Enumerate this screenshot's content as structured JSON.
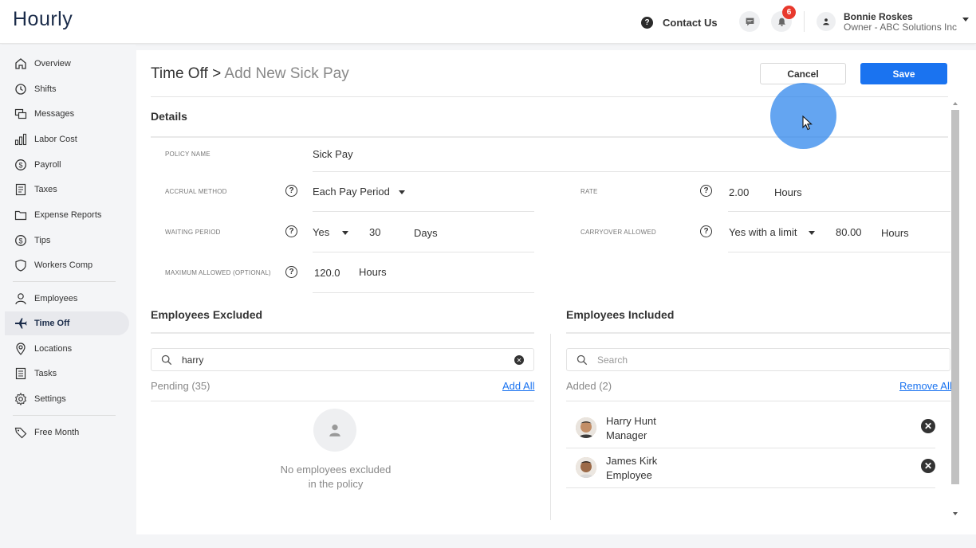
{
  "header": {
    "logo": "Hourly",
    "contact_label": "Contact Us",
    "notification_count": "6",
    "user_name": "Bonnie Roskes",
    "user_role": "Owner - ABC Solutions Inc"
  },
  "sidebar": {
    "items": [
      {
        "label": "Overview",
        "icon": "home-icon"
      },
      {
        "label": "Shifts",
        "icon": "clock-icon"
      },
      {
        "label": "Messages",
        "icon": "chat-icon"
      },
      {
        "label": "Labor Cost",
        "icon": "bar-chart-icon"
      },
      {
        "label": "Payroll",
        "icon": "dollar-circle-icon"
      },
      {
        "label": "Taxes",
        "icon": "document-icon"
      },
      {
        "label": "Expense Reports",
        "icon": "folder-icon"
      },
      {
        "label": "Tips",
        "icon": "dollar-circle-icon"
      },
      {
        "label": "Workers Comp",
        "icon": "shield-icon"
      },
      {
        "label": "Employees",
        "icon": "person-icon"
      },
      {
        "label": "Time Off",
        "icon": "airplane-icon"
      },
      {
        "label": "Locations",
        "icon": "location-pin-icon"
      },
      {
        "label": "Tasks",
        "icon": "tasks-icon"
      },
      {
        "label": "Settings",
        "icon": "gear-icon"
      },
      {
        "label": "Free Month",
        "icon": "tag-icon"
      }
    ],
    "active": "Time Off"
  },
  "page": {
    "breadcrumb_root": "Time Off",
    "breadcrumb_sep": ">",
    "breadcrumb_current": "Add New Sick Pay",
    "cancel_label": "Cancel",
    "save_label": "Save"
  },
  "details": {
    "title": "Details",
    "policy_name_label": "POLICY NAME",
    "policy_name": "Sick Pay",
    "accrual_method_label": "ACCRUAL METHOD",
    "accrual_method": "Each Pay Period",
    "rate_label": "RATE",
    "rate_value": "2.00",
    "rate_unit": "Hours",
    "waiting_period_label": "WAITING PERIOD",
    "waiting_period_enabled": "Yes",
    "waiting_period_value": "30",
    "waiting_period_unit": "Days",
    "carryover_label": "CARRYOVER ALLOWED",
    "carryover_value": "Yes with a limit",
    "carryover_amount": "80.00",
    "carryover_unit": "Hours",
    "max_allowed_label": "MAXIMUM ALLOWED (OPTIONAL)",
    "max_allowed_value": "120.0",
    "max_allowed_unit": "Hours"
  },
  "excluded": {
    "title": "Employees Excluded",
    "search_value": "harry",
    "pending_label": "Pending (35)",
    "add_all_label": "Add All",
    "empty_line1": "No employees excluded",
    "empty_line2": "in the policy"
  },
  "included": {
    "title": "Employees Included",
    "search_placeholder": "Search",
    "added_label": "Added (2)",
    "remove_all_label": "Remove All",
    "employees": [
      {
        "name": "Harry Hunt",
        "role": "Manager"
      },
      {
        "name": "James Kirk",
        "role": "Employee"
      }
    ]
  },
  "colors": {
    "accent": "#1a73f0",
    "badge": "#e8392d",
    "logo": "#1a2b49"
  }
}
